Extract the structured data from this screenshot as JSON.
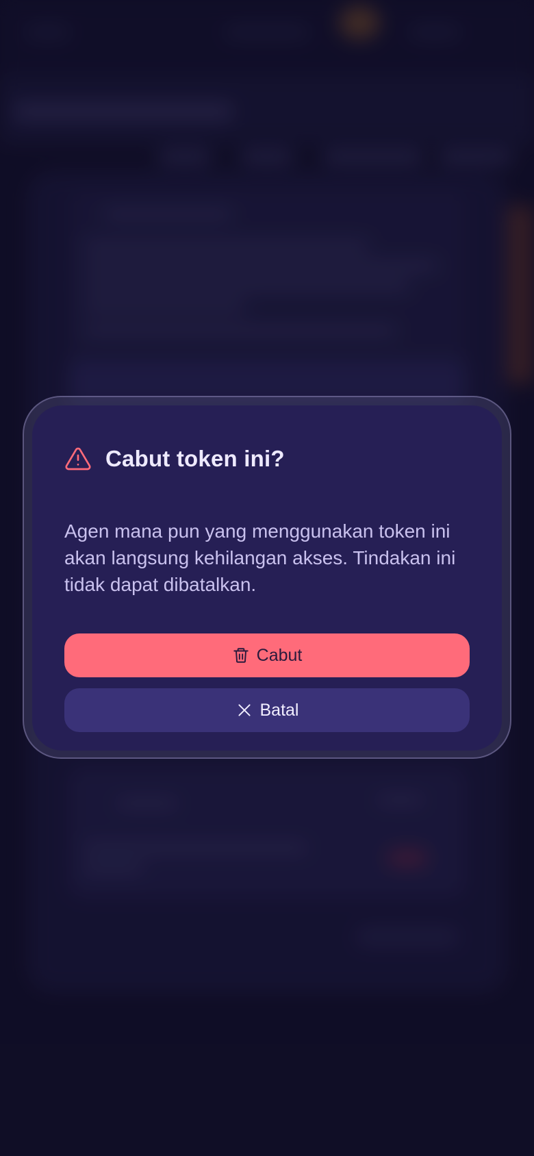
{
  "dialog": {
    "title": "Cabut token ini?",
    "body": "Agen mana pun yang menggunakan token ini akan langsung kehilangan akses. Tindakan ini tidak dapat dibatalkan.",
    "title_icon": "warning-triangle-icon",
    "confirm": {
      "label": "Cabut",
      "icon": "trash-icon",
      "color": "#ff6b7a"
    },
    "cancel": {
      "label": "Batal",
      "icon": "close-icon",
      "color": "#3a3278"
    }
  },
  "colors": {
    "page_bg": "#12102a",
    "dialog_bg": "#261f55",
    "danger": "#ff6b7a",
    "title_text": "#eeeaff",
    "body_text": "#c9c1ee"
  }
}
